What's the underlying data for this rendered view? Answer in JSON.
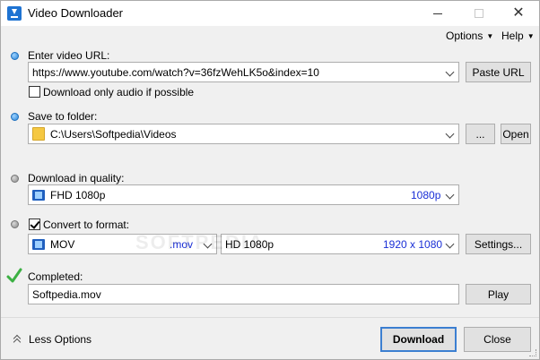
{
  "window": {
    "title": "Video Downloader"
  },
  "menu": {
    "options_label": "Options",
    "help_label": "Help"
  },
  "url_section": {
    "label": "Enter video URL:",
    "url_value": "https://www.youtube.com/watch?v=36fzWehLK5o&index=10",
    "paste_label": "Paste URL",
    "audio_only_label": "Download only audio if possible",
    "audio_only_checked": false
  },
  "folder_section": {
    "label": "Save to folder:",
    "path": "C:\\Users\\Softpedia\\Videos",
    "browse_label": "...",
    "open_label": "Open"
  },
  "quality_section": {
    "label": "Download in quality:",
    "selected": "FHD 1080p",
    "selected_detail": "1080p"
  },
  "convert_section": {
    "label": "Convert to format:",
    "checked": true,
    "format": "MOV",
    "format_ext": ".mov",
    "resolution": "HD 1080p",
    "resolution_detail": "1920 x 1080",
    "settings_label": "Settings..."
  },
  "completed_section": {
    "label": "Completed:",
    "filename": "Softpedia.mov",
    "play_label": "Play"
  },
  "footer": {
    "less_options_label": "Less Options",
    "download_label": "Download",
    "close_label": "Close"
  },
  "watermark": "SOFTPEDIA",
  "colors": {
    "accent": "#3c7fd1",
    "detail_text": "#1a2fd6",
    "success": "#3cb043"
  }
}
